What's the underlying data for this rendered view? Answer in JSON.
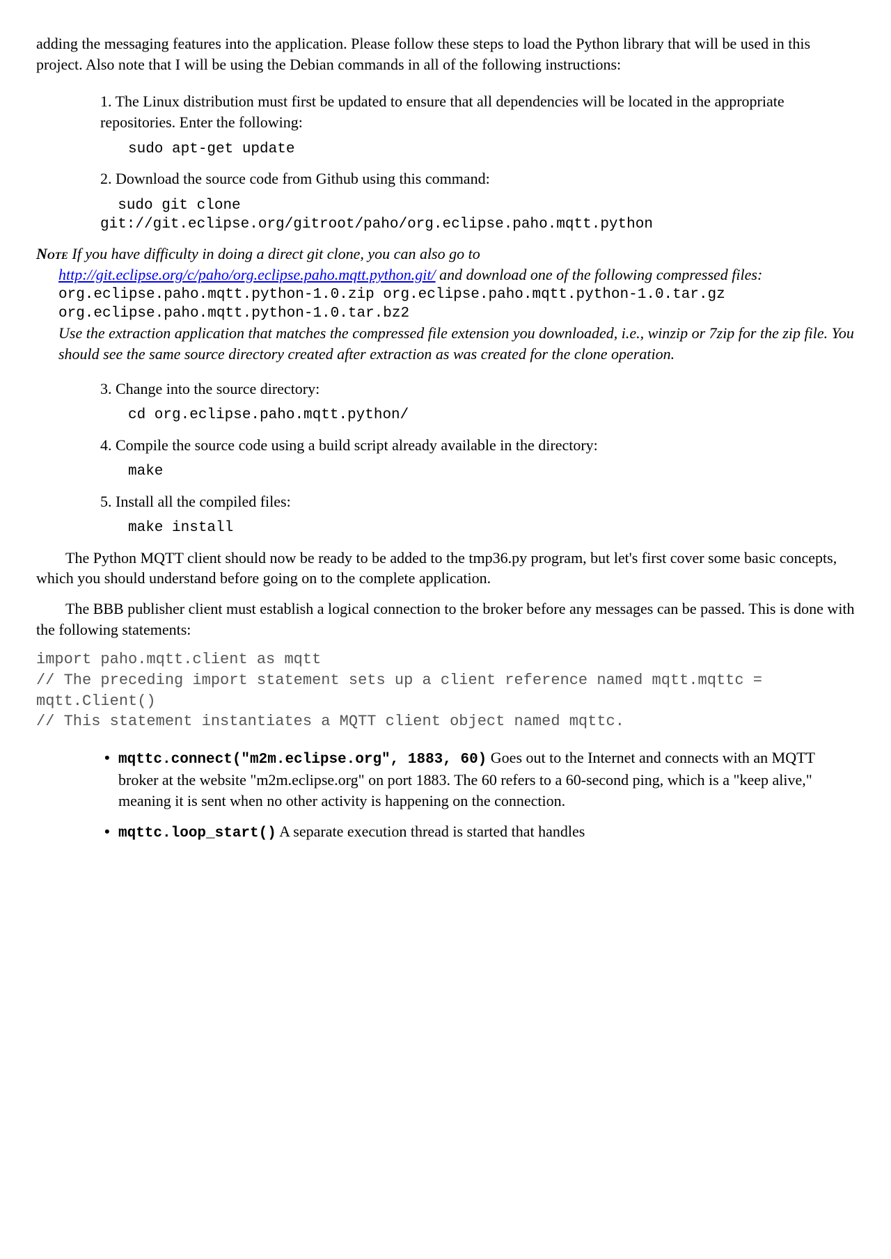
{
  "intro": "adding the messaging features into the application. Please follow these steps to load the Python library that will be used in this project. Also note that I will be using the Debian commands in all of the following instructions:",
  "steps_a": {
    "s1": "1. The Linux distribution must first be updated to ensure that all dependencies will be located in the appropriate repositories. Enter the following:",
    "s1_code": "sudo apt-get update",
    "s2": "2. Download the source code from Github using this command:",
    "s2_code": "  sudo git clone\ngit://git.eclipse.org/gitroot/paho/org.eclipse.paho.mqtt.python"
  },
  "note": {
    "label": "Note",
    "lead1": " If you have difficulty in doing a direct git clone, you can also go to ",
    "link": "http://git.eclipse.org/c/paho/org.eclipse.paho.mqtt.python.git/",
    "lead2": " and download one of the following compressed files:",
    "files": "org.eclipse.paho.mqtt.python-1.0.zip\norg.eclipse.paho.mqtt.python-1.0.tar.gz\norg.eclipse.paho.mqtt.python-1.0.tar.bz2",
    "trail": "Use the extraction application that matches the compressed file extension you downloaded, i.e., winzip or 7zip for the zip file. You should see the same source directory created after extraction as was created for the clone operation"
  },
  "steps_b": {
    "s3": "3. Change into the source directory:",
    "s3_code": "cd org.eclipse.paho.mqtt.python/",
    "s4": "4. Compile the source code using a build script already available in the directory:",
    "s4_code": "make",
    "s5": "5. Install all the compiled files:",
    "s5_code": "make install"
  },
  "para1": "The Python MQTT client should now be ready to be added to the tmp36.py program, but let's first cover some basic concepts, which you should understand before going on to the complete application.",
  "para2": "The BBB publisher client must establish a logical connection to the broker before any messages can be passed. This is done with the following statements:",
  "codelisting": "import paho.mqtt.client as mqtt\n// The preceding import statement sets up a client reference named mqtt.mqttc = mqtt.Client()\n// This statement instantiates a MQTT client object named mqttc.",
  "bullets": {
    "b1_code": "mqttc.connect(\"m2m.eclipse.org\", 1883, 60)",
    "b1_text": " Goes out to the Internet and connects with an MQTT broker at the website \"m2m.eclipse.org\" on port 1883. The 60 refers to a 60-second ping, which is a \"keep alive,\" meaning it is sent when no other activity is happening on the connection.",
    "b2_code": "mqttc.loop_start()",
    "b2_text": " A separate execution thread is started that handles"
  }
}
